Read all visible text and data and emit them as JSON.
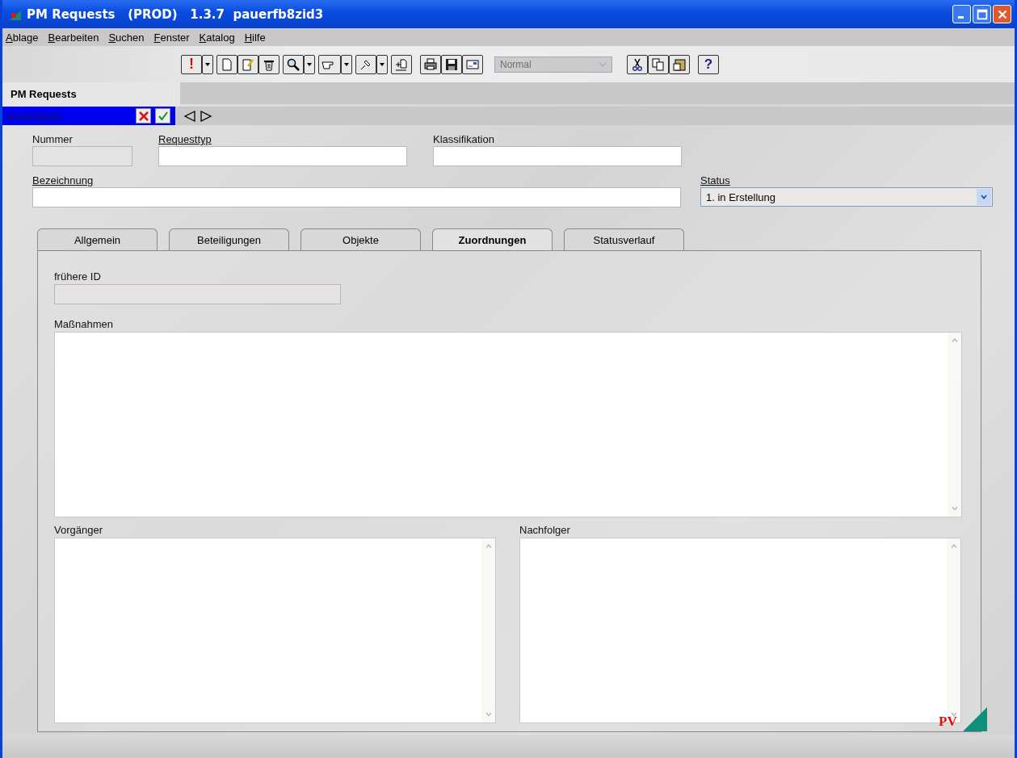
{
  "window": {
    "title": "PM Requests   (PROD)   1.3.7  pauerfb8zid3"
  },
  "menu": [
    "Ablage",
    "Bearbeiten",
    "Suchen",
    "Fenster",
    "Katalog",
    "Hilfe"
  ],
  "toolbar": {
    "alert_label": "!",
    "view_combo": {
      "value": "Normal",
      "disabled": true
    },
    "help_label": "?"
  },
  "module_title": "PM Requests",
  "mode_bar": {
    "label": "Neueingabe"
  },
  "header_fields": [
    {
      "label": "Nummer",
      "required": false,
      "disabled": true
    },
    {
      "label": "Requesttyp",
      "required": true,
      "disabled": false
    },
    {
      "label": "Klassifikation",
      "required": false,
      "disabled": false
    }
  ],
  "designation": {
    "label": "Bezeichnung",
    "required": true
  },
  "status": {
    "label": "Status",
    "required": true,
    "value": "1. in Erstellung"
  },
  "tabs": [
    {
      "label": "Allgemein",
      "selected": false
    },
    {
      "label": "Beteiligungen",
      "selected": false
    },
    {
      "label": "Objekte",
      "selected": false
    },
    {
      "label": "Zuordnungen",
      "selected": true
    },
    {
      "label": "Statusverlauf",
      "selected": false
    }
  ],
  "panel": {
    "former_id": {
      "label": "frühere ID",
      "disabled": true
    },
    "measures": {
      "label": "Maßnahmen"
    },
    "predecessor": {
      "label": "Vorgänger"
    },
    "successor": {
      "label": "Nachfolger"
    }
  },
  "logo": {
    "text": "PV"
  }
}
